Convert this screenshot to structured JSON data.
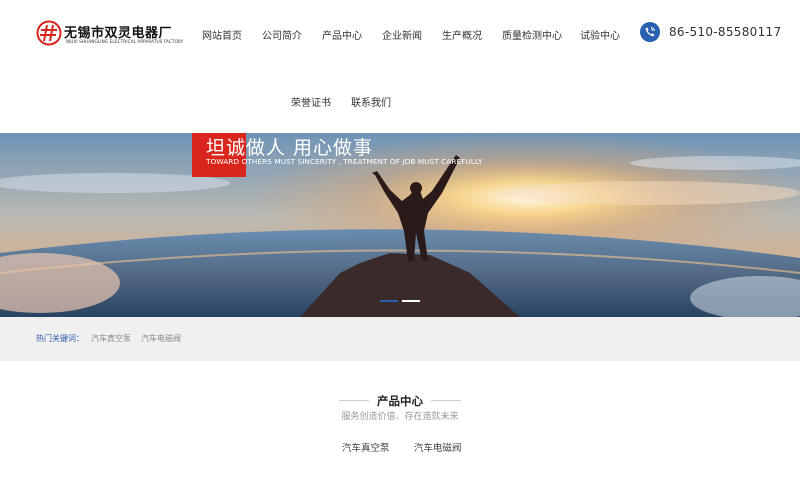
{
  "header": {
    "company_name": "无锡市双灵电器厂",
    "company_name_en": "WUXI SHUANGLING ELECTRICAL APPARATUS FACTORY",
    "logo_icon": "shuangling-logo",
    "brand_color": "#d9251c",
    "nav": [
      {
        "label": "网站首页"
      },
      {
        "label": "公司简介"
      },
      {
        "label": "产品中心"
      },
      {
        "label": "企业新闻"
      },
      {
        "label": "生产概况"
      },
      {
        "label": "质量检测中心"
      },
      {
        "label": "试验中心"
      },
      {
        "label": "荣誉证书"
      },
      {
        "label": "联系我们"
      }
    ],
    "phone_icon": "phone-icon",
    "phone": "86-510-85580117"
  },
  "banner": {
    "slogan_cn": "坦诚做人 用心做事",
    "slogan_en": "TOWARD OTHERS MUST SINCERITY , TREATMENT OF JOB MUST CAREFULLY",
    "slide_count": 2,
    "active_slide": 1
  },
  "keywords": {
    "label": "热门关键词：",
    "links": [
      "汽车真空泵",
      "汽车电磁阀"
    ]
  },
  "products": {
    "title": "产品中心",
    "subtitle": "服务创造价值、存在造就未来",
    "tabs": [
      "汽车真空泵",
      "汽车电磁阀"
    ]
  }
}
